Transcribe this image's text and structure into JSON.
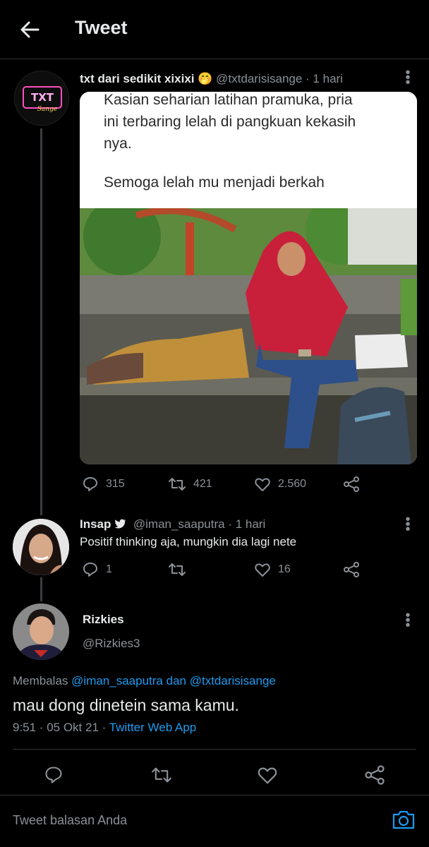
{
  "header": {
    "title": "Tweet",
    "back_icon": "arrow-left-icon"
  },
  "tweet": {
    "author_name": "txt dari sedikit xixixi",
    "author_emoji": "🤭",
    "handle": "@txtdarisisange",
    "time": "· 1 hari",
    "avatar_text": "TXT",
    "media": {
      "line1": "Kasian seharian latihan pramuka, pria",
      "line2": "ini terbaring lelah di pangkuan kekasih",
      "line3": "nya.",
      "line4": "Semoga lelah mu menjadi berkah"
    },
    "replies": "315",
    "retweets": "421",
    "likes": "2.560"
  },
  "reply1": {
    "author_name": "Insap",
    "handle": "@iman_saaputra",
    "time": "· 1 hari",
    "text": "Positif thinking aja, mungkin dia lagi nete",
    "replies": "1",
    "retweets": "",
    "likes": "16"
  },
  "reply2": {
    "author_name": "Rizkies",
    "handle": "@Rizkies3",
    "replying_prefix": "Membalas",
    "replying_to_1": "@iman_saaputra",
    "replying_and": "dan",
    "replying_to_2": "@txtdarisisange",
    "text": "mau dong dinetein sama kamu.",
    "time": "9:51 · 05 Okt 21 ·",
    "client": "Twitter Web App"
  },
  "composer": {
    "placeholder": "Tweet balasan Anda",
    "camera_icon": "camera-icon"
  },
  "colors": {
    "background": "#000000",
    "link": "#1d9bf0",
    "muted": "#8b9197",
    "text": "#e7e9ea",
    "divider": "#2f3336",
    "hijab": "#c8203a"
  }
}
